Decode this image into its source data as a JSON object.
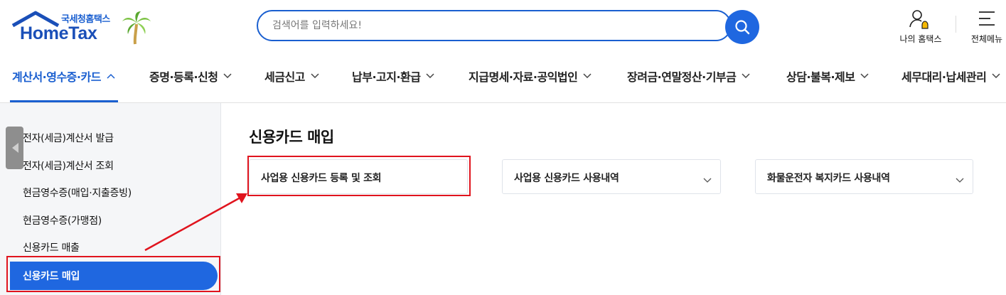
{
  "header": {
    "logo_small": "국세청홈택스",
    "logo_main": "HomeTax",
    "search_placeholder": "검색어를 입력하세요!",
    "my_hometax_label": "나의 홈택스",
    "all_menu_label": "전체메뉴"
  },
  "gnb": {
    "items": [
      {
        "label": "계산서·영수증·카드",
        "active": true
      },
      {
        "label": "증명·등록·신청"
      },
      {
        "label": "세금신고"
      },
      {
        "label": "납부·고지·환급"
      },
      {
        "label": "지급명세·자료·공익법인"
      },
      {
        "label": "장려금·연말정산·기부금"
      },
      {
        "label": "상담·불복·제보"
      },
      {
        "label": "세무대리·납세관리"
      }
    ]
  },
  "sidebar": {
    "items": [
      {
        "label": "전자(세금)계산서 발급"
      },
      {
        "label": "전자(세금)계산서 조회"
      },
      {
        "label": "현금영수증(매입·지출증빙)"
      },
      {
        "label": "현금영수증(가맹점)"
      },
      {
        "label": "신용카드 매출"
      },
      {
        "label": "신용카드 매입",
        "active": true
      }
    ]
  },
  "main": {
    "title": "신용카드 매입",
    "cards": [
      {
        "label": "사업용 신용카드 등록 및 조회",
        "highlighted": true
      },
      {
        "label": "사업용 신용카드 사용내역"
      },
      {
        "label": "화물운전자 복지카드 사용내역"
      }
    ]
  },
  "colors": {
    "brand_blue": "#1f67e0",
    "highlight_red": "#e0141e",
    "handle_gray": "#8e8e8e"
  },
  "icons": [
    "search-icon",
    "user-bell-icon",
    "hamburger-icon",
    "chevron-down-icon",
    "chevron-up-icon",
    "collapse-left-icon",
    "palm-tree-icon"
  ]
}
